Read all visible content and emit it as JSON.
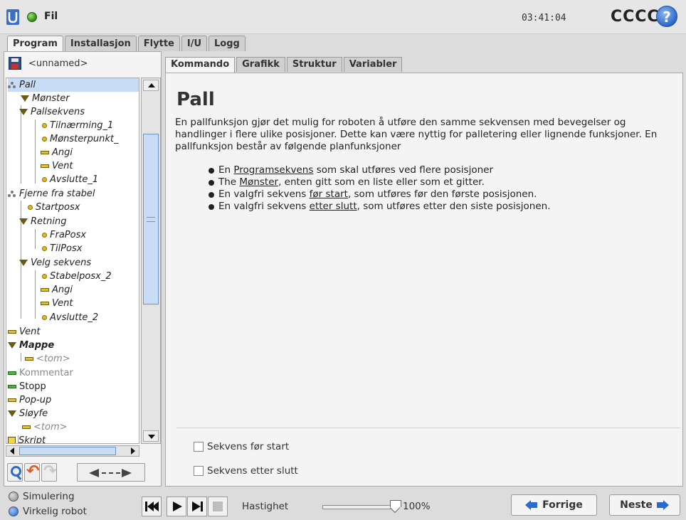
{
  "header": {
    "menu_label": "Fil",
    "clock": "03:41:04",
    "robot_name": "CCCC",
    "help_glyph": "?"
  },
  "top_tabs": [
    "Program",
    "Installasjon",
    "Flytte",
    "I/U",
    "Logg"
  ],
  "program": {
    "name": "<unnamed>"
  },
  "tree": [
    {
      "label": "Pall",
      "icon": "pallet-icon"
    },
    {
      "label": "Mønster",
      "icon": "folder-triangle-icon"
    },
    {
      "label": "Pallsekvens",
      "icon": "folder-triangle-icon"
    },
    {
      "label": "Tilnærming_1",
      "icon": "waypoint-icon"
    },
    {
      "label": "Mønsterpunkt_",
      "icon": "waypoint-icon"
    },
    {
      "label": "Angi",
      "icon": "command-icon"
    },
    {
      "label": "Vent",
      "icon": "command-icon"
    },
    {
      "label": "Avslutte_1",
      "icon": "waypoint-icon"
    },
    {
      "label": "Fjerne fra stabel",
      "icon": "pallet-icon"
    },
    {
      "label": "Startposx",
      "icon": "waypoint-icon"
    },
    {
      "label": "Retning",
      "icon": "folder-triangle-icon"
    },
    {
      "label": "FraPosx",
      "icon": "waypoint-icon"
    },
    {
      "label": "TilPosx",
      "icon": "waypoint-icon"
    },
    {
      "label": "Velg sekvens",
      "icon": "folder-triangle-icon"
    },
    {
      "label": "Stabelposx_2",
      "icon": "waypoint-icon"
    },
    {
      "label": "Angi",
      "icon": "command-icon"
    },
    {
      "label": "Vent",
      "icon": "command-icon"
    },
    {
      "label": "Avslutte_2",
      "icon": "waypoint-icon"
    },
    {
      "label": "Vent",
      "icon": "command-icon"
    },
    {
      "label": "Mappe",
      "icon": "folder-triangle-icon"
    },
    {
      "label": "<tom>",
      "icon": "command-icon"
    },
    {
      "label": "Kommentar",
      "icon": "command-icon"
    },
    {
      "label": "Stopp",
      "icon": "command-icon"
    },
    {
      "label": "Pop-up",
      "icon": "command-icon"
    },
    {
      "label": "Sløyfe",
      "icon": "folder-triangle-icon"
    },
    {
      "label": "<tom>",
      "icon": "command-icon"
    },
    {
      "label": "Skript",
      "icon": "script-icon"
    }
  ],
  "sub_tabs": [
    "Kommando",
    "Grafikk",
    "Struktur",
    "Variabler"
  ],
  "content": {
    "title": "Pall",
    "description": "En pallfunksjon gjør det mulig for roboten å utføre den samme sekvensen med bevegelser og handlinger i flere ulike posisjoner. Dette kan være nyttig for palletering eller lignende funksjoner. En pallfunksjon består av følgende planfunksjoner",
    "bullets": [
      {
        "pre": "En ",
        "link": "Programsekvens",
        "post": " som skal utføres ved flere posisjoner"
      },
      {
        "pre": "The ",
        "link": "Mønster",
        "post": ", enten gitt som en liste eller som et gitter."
      },
      {
        "pre": "En valgfri sekvens ",
        "link": "før start",
        "post": ", som utføres før den første posisjonen."
      },
      {
        "pre": "En valgfri sekvens ",
        "link": "etter slutt",
        "post": ", som utføres etter den siste posisjonen."
      }
    ],
    "option_before": "Sekvens før start",
    "option_after": "Sekvens etter slutt"
  },
  "footer": {
    "mode_sim": "Simulering",
    "mode_real": "Virkelig robot",
    "speed_label": "Hastighet",
    "speed_value": "100%",
    "speed_fraction": 1.0,
    "prev_label": "Forrige",
    "next_label": "Neste"
  }
}
